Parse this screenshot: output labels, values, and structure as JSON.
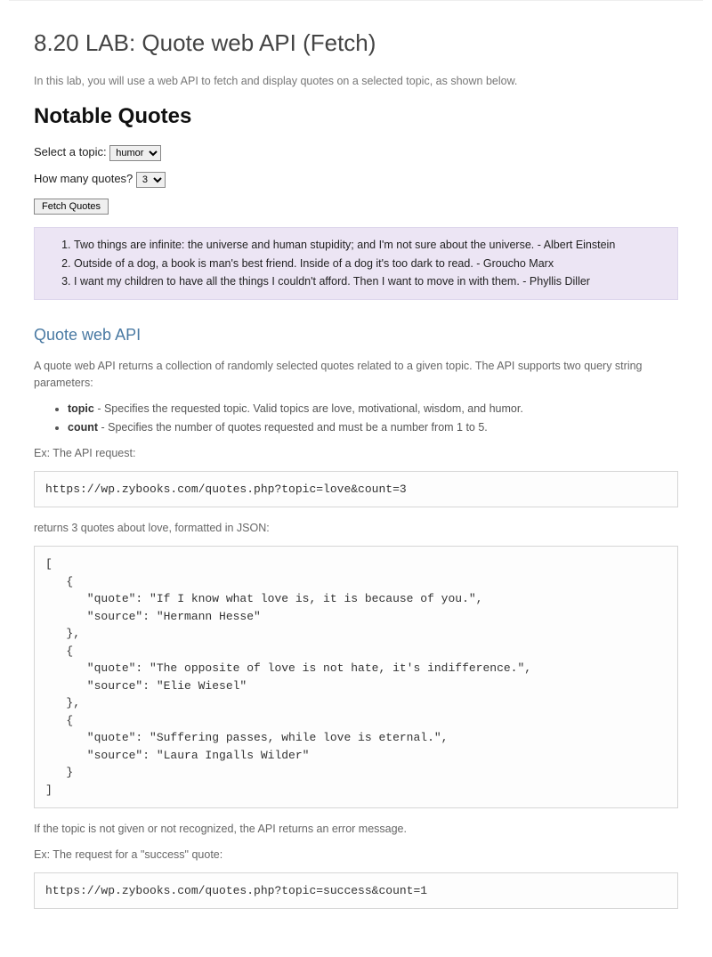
{
  "labTitle": "8.20 LAB: Quote web API (Fetch)",
  "intro": "In this lab, you will use a web API to fetch and display quotes on a selected topic, as shown below.",
  "example": {
    "heading": "Notable Quotes",
    "topic": {
      "label": "Select a topic:",
      "selected": "humor"
    },
    "count": {
      "label": "How many quotes?",
      "selected": "3"
    },
    "fetchButton": "Fetch Quotes",
    "quotes": [
      "Two things are infinite: the universe and human stupidity; and I'm not sure about the universe. - Albert Einstein",
      "Outside of a dog, a book is man's best friend. Inside of a dog it's too dark to read. - Groucho Marx",
      "I want my children to have all the things I couldn't afford. Then I want to move in with them. - Phyllis Diller"
    ]
  },
  "api": {
    "heading": "Quote web API",
    "desc": "A quote web API returns a collection of randomly selected quotes related to a given topic. The API supports two query string parameters:",
    "params": [
      {
        "name": "topic",
        "desc": " - Specifies the requested topic. Valid topics are love, motivational, wisdom, and humor."
      },
      {
        "name": "count",
        "desc": " - Specifies the number of quotes requested and must be a number from 1 to 5."
      }
    ],
    "exLabel1": "Ex: The API request:",
    "request1": "https://wp.zybooks.com/quotes.php?topic=love&count=3",
    "returns1": "returns 3 quotes about love, formatted in JSON:",
    "jsonResponse": "[\n   {\n      \"quote\": \"If I know what love is, it is because of you.\",\n      \"source\": \"Hermann Hesse\"\n   },\n   {\n      \"quote\": \"The opposite of love is not hate, it's indifference.\",\n      \"source\": \"Elie Wiesel\"\n   },\n   {\n      \"quote\": \"Suffering passes, while love is eternal.\",\n      \"source\": \"Laura Ingalls Wilder\"\n   }\n]",
    "errorNote": "If the topic is not given or not recognized, the API returns an error message.",
    "exLabel2": "Ex: The request for a \"success\" quote:",
    "request2": "https://wp.zybooks.com/quotes.php?topic=success&count=1"
  }
}
